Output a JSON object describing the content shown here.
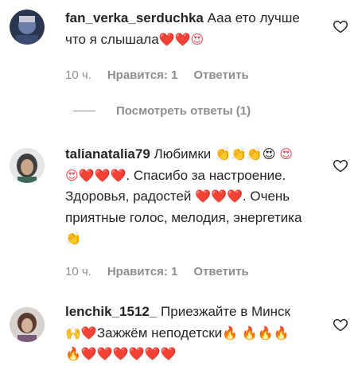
{
  "comments": [
    {
      "username": "fan_verka_serduchka",
      "text": "Ааа ето лучше что я слышала",
      "emoji": "❤️❤️😍",
      "time": "10 ч.",
      "likes": "Нравится: 1",
      "reply_label": "Ответить",
      "like_icon": "heart-outline-icon"
    },
    {
      "username": "talianatalia79",
      "text_1": "Любимки",
      "emoji_1": "👏👏👏😍",
      "emoji_2": "😍😍❤️❤️❤️",
      "text_2": ". Спасибо за настроение. Здоровья, радостей",
      "emoji_3": "❤️❤️❤️",
      "text_3": ". Очень приятные голос, мелодия, энергетика",
      "emoji_4": "👏",
      "time": "10 ч.",
      "likes": "Нравится: 1",
      "reply_label": "Ответить",
      "like_icon": "heart-outline-icon"
    },
    {
      "username": "lenchik_1512_",
      "text_1": "Приезжайте в Минск",
      "emoji_1": "🙌❤️",
      "text_2": "Зажжём неподетски",
      "emoji_2": "🔥",
      "emoji_3": "🔥🔥🔥🔥❤️❤️❤️❤️❤️❤️",
      "like_icon": "heart-outline-icon"
    }
  ],
  "replies_toggle": "Посмотреть ответы (1)",
  "colors": {
    "text": "#262626",
    "secondary": "#8e8e8e",
    "heart": "#ed4956"
  }
}
